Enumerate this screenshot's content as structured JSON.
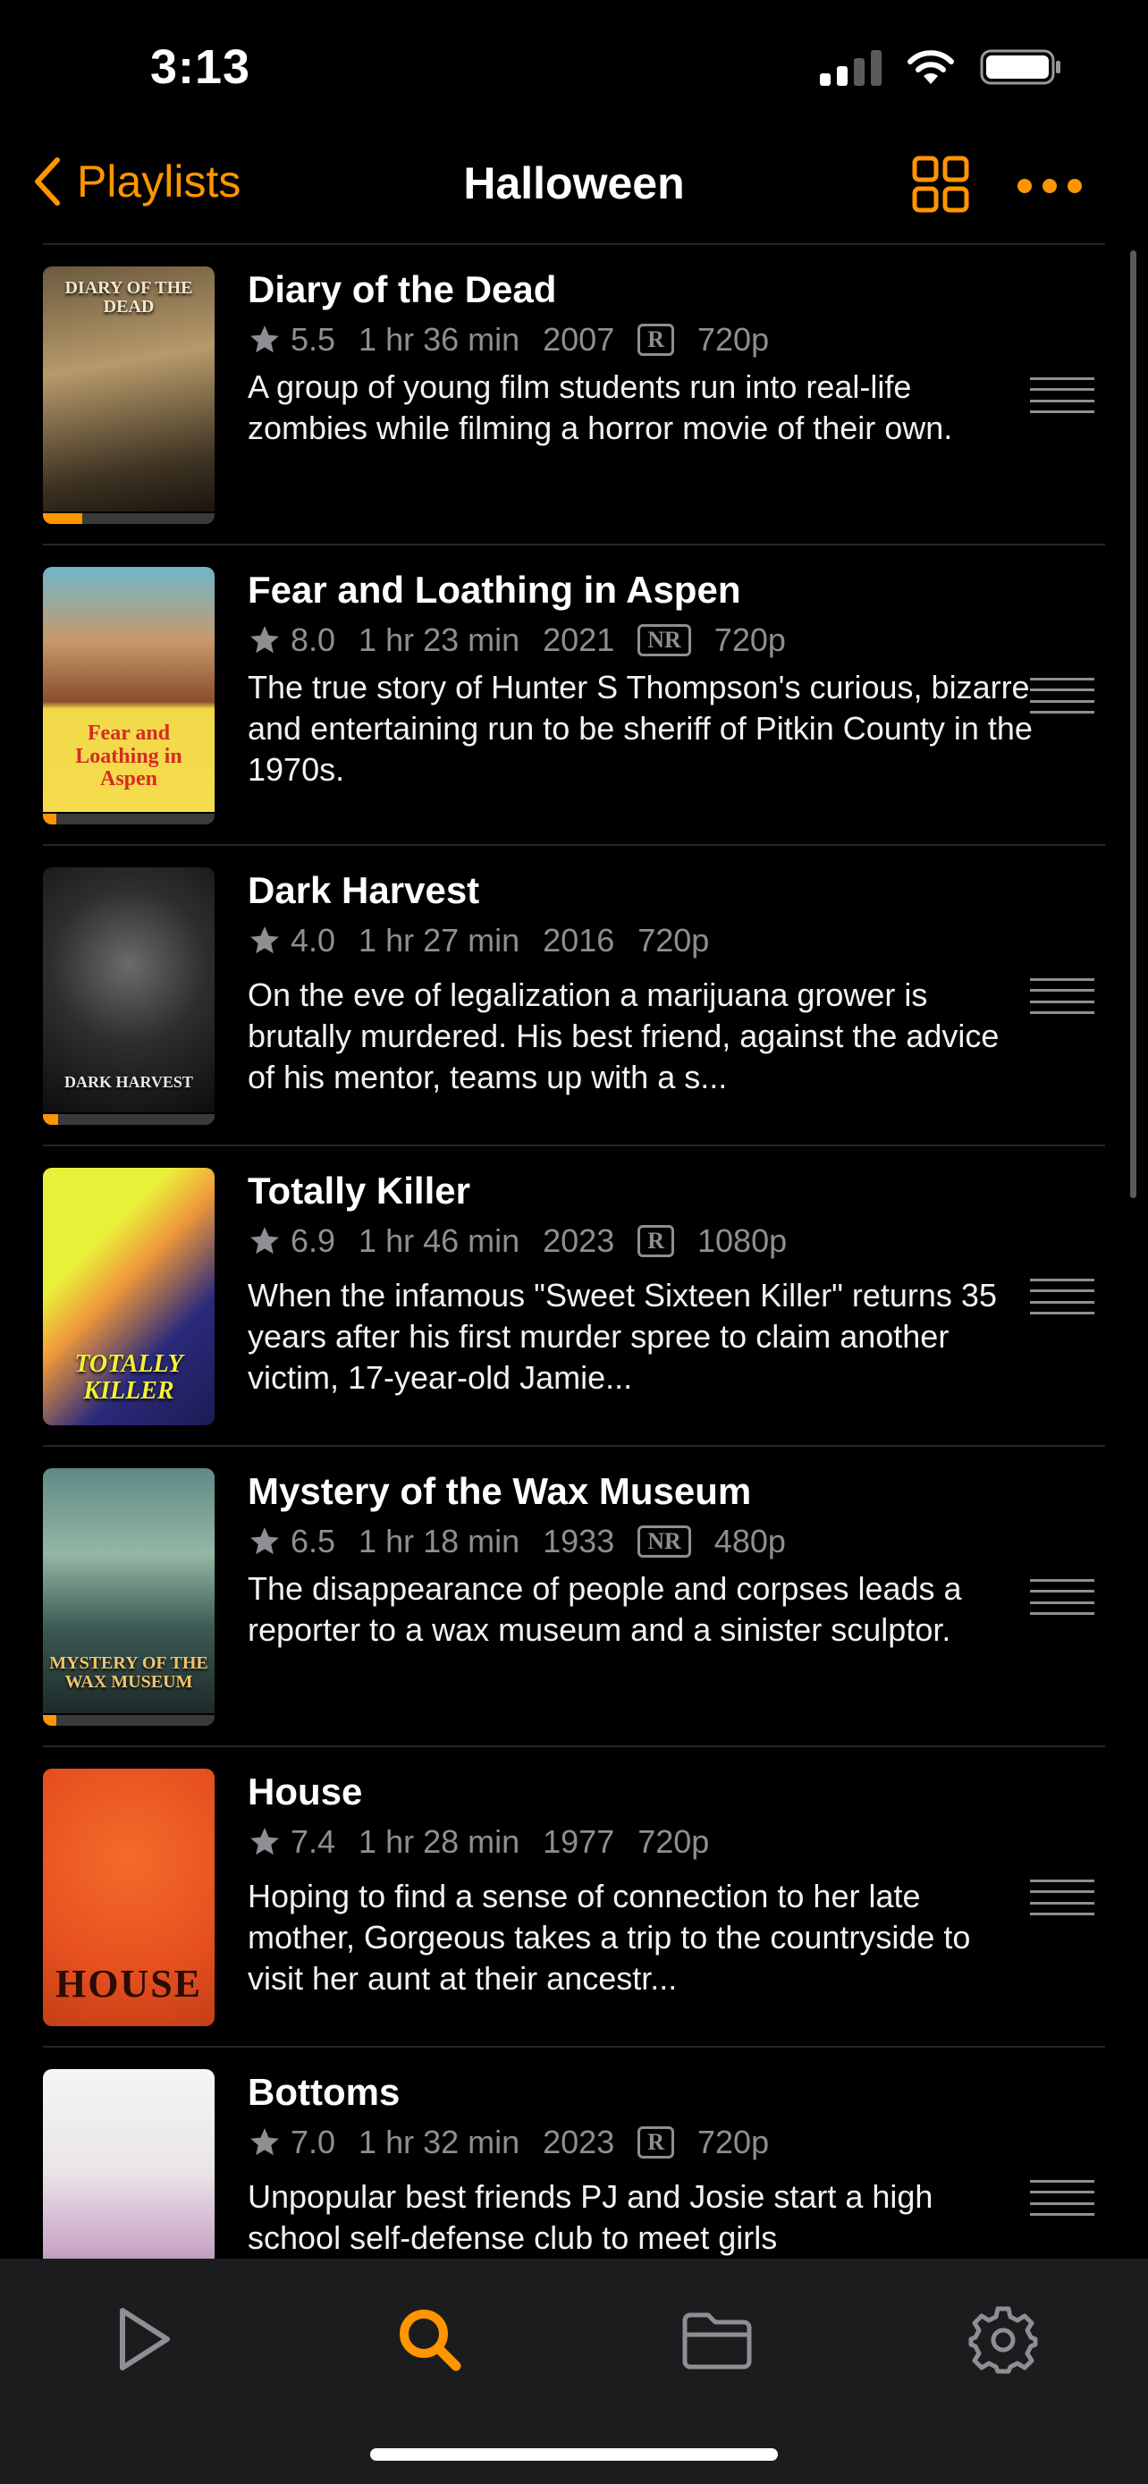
{
  "status_bar": {
    "time": "3:13"
  },
  "nav": {
    "back_label": "Playlists",
    "title": "Halloween"
  },
  "colors": {
    "accent": "#ff9500",
    "background": "#000000",
    "secondary_text": "#8e8e93"
  },
  "movies": [
    {
      "title": "Diary of the Dead",
      "rating": "5.5",
      "duration": "1 hr 36 min",
      "year": "2007",
      "content_rating": "R",
      "resolution": "720p",
      "description": "A group of young film students run into real-life zombies while filming a horror movie of their own.",
      "poster_text": "DIARY OF THE DEAD",
      "progress": 0.23
    },
    {
      "title": "Fear and Loathing in Aspen",
      "rating": "8.0",
      "duration": "1 hr 23 min",
      "year": "2021",
      "content_rating": "NR",
      "resolution": "720p",
      "description": "The true story of Hunter S Thompson's curious, bizarre and entertaining run to be sheriff of Pitkin County in the 1970s.",
      "poster_text": "Fear and Loathing in Aspen",
      "progress": 0.08
    },
    {
      "title": "Dark Harvest",
      "rating": "4.0",
      "duration": "1 hr 27 min",
      "year": "2016",
      "content_rating": "",
      "resolution": "720p",
      "description": "On the eve of legalization a marijuana grower is brutally murdered. His best friend, against the advice of his mentor, teams up with a s...",
      "poster_text": "DARK HARVEST",
      "progress": 0.09
    },
    {
      "title": "Totally Killer",
      "rating": "6.9",
      "duration": "1 hr 46 min",
      "year": "2023",
      "content_rating": "R",
      "resolution": "1080p",
      "description": "When the infamous \"Sweet Sixteen Killer\" returns 35 years after his first murder spree to claim another victim, 17-year-old Jamie...",
      "poster_text": "TOTALLY KILLER",
      "progress": 0
    },
    {
      "title": "Mystery of the Wax Museum",
      "rating": "6.5",
      "duration": "1 hr 18 min",
      "year": "1933",
      "content_rating": "NR",
      "resolution": "480p",
      "description": "The disappearance of people and corpses leads a reporter to a wax museum and a sinister sculptor.",
      "poster_text": "MYSTERY OF THE WAX MUSEUM",
      "progress": 0.08
    },
    {
      "title": "House",
      "rating": "7.4",
      "duration": "1 hr 28 min",
      "year": "1977",
      "content_rating": "",
      "resolution": "720p",
      "description": "Hoping to find a sense of connection to her late mother, Gorgeous takes a trip to the countryside to visit her aunt at their ancestr...",
      "poster_text": "HOUSE",
      "progress": 0
    },
    {
      "title": "Bottoms",
      "rating": "7.0",
      "duration": "1 hr 32 min",
      "year": "2023",
      "content_rating": "R",
      "resolution": "720p",
      "description": "Unpopular best friends PJ and Josie start a high school self-defense club to meet girls",
      "poster_text": "",
      "progress": 0
    }
  ],
  "tabs": [
    {
      "icon": "play-icon",
      "active": false
    },
    {
      "icon": "search-icon",
      "active": true
    },
    {
      "icon": "folder-icon",
      "active": false
    },
    {
      "icon": "gear-icon",
      "active": false
    }
  ]
}
